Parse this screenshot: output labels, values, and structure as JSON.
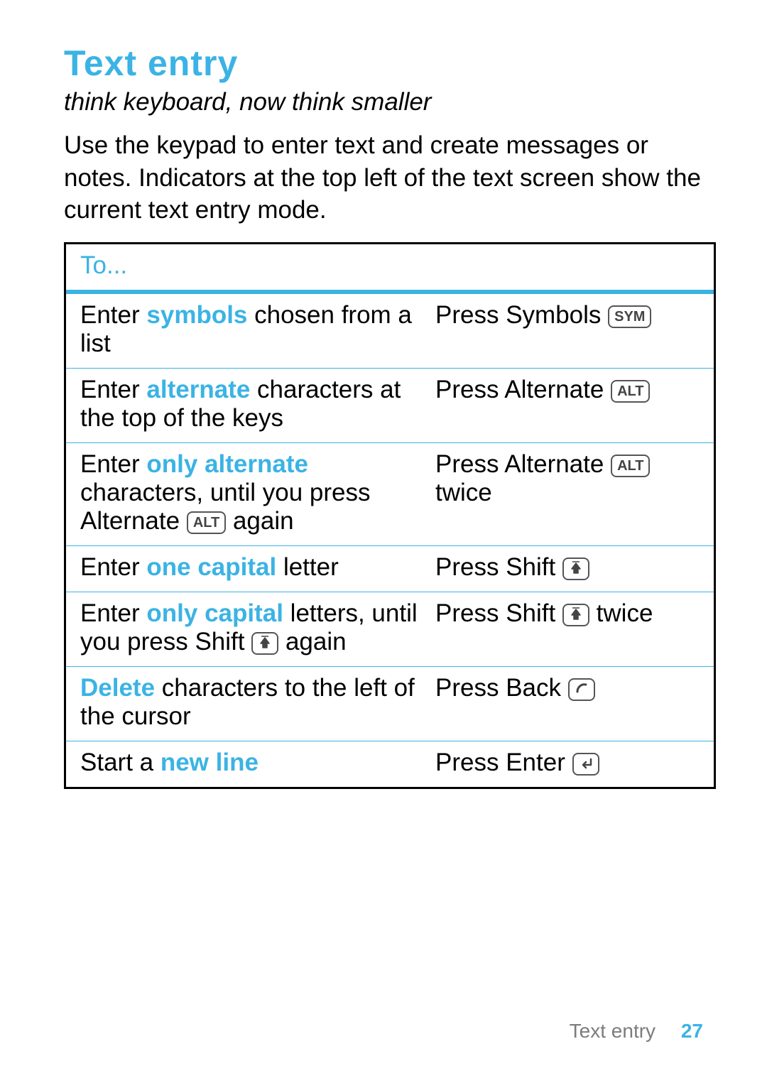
{
  "title": "Text entry",
  "subtitle": "think keyboard, now think smaller",
  "intro": "Use the keypad to enter text and create messages or notes. Indicators at the top left of the text screen show the current text entry mode.",
  "table_header": "To...",
  "keys": {
    "sym": "SYM",
    "alt": "ALT"
  },
  "rows": {
    "r1": {
      "c1_a": "Enter ",
      "c1_kw": "symbols",
      "c1_b": " chosen from a list",
      "c2_a": "Press Symbols "
    },
    "r2": {
      "c1_a": "Enter ",
      "c1_kw": "alternate",
      "c1_b": " characters at the top of the keys",
      "c2_a": "Press Alternate "
    },
    "r3": {
      "c1_a": "Enter ",
      "c1_kw": "only alternate",
      "c1_b": " characters, until you press Alternate ",
      "c1_c": " again",
      "c2_a": "Press Alternate ",
      "c2_b": " twice"
    },
    "r4": {
      "c1_a": "Enter ",
      "c1_kw": "one capital",
      "c1_b": " letter",
      "c2_a": "Press Shift "
    },
    "r5": {
      "c1_a": "Enter ",
      "c1_kw": "only capital",
      "c1_b": " letters, until you press Shift ",
      "c1_c": " again",
      "c2_a": "Press Shift ",
      "c2_b": " twice"
    },
    "r6": {
      "c1_kw": "Delete",
      "c1_b": " characters to the left of the cursor",
      "c2_a": "Press Back "
    },
    "r7": {
      "c1_a": "Start a ",
      "c1_kw": "new line",
      "c2_a": "Press Enter "
    }
  },
  "footer_label": "Text entry",
  "footer_page": "27"
}
